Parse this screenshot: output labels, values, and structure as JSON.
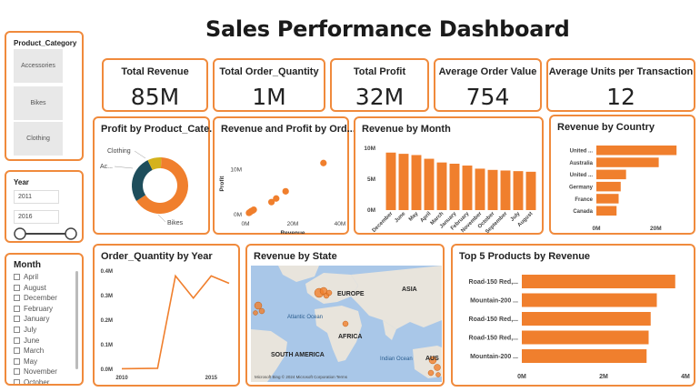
{
  "dashboard": {
    "title": "Sales Performance Dashboard"
  },
  "kpis": [
    {
      "label": "Total Revenue",
      "value": "85M"
    },
    {
      "label": "Total Order_Quantity",
      "value": "1M"
    },
    {
      "label": "Total Profit",
      "value": "32M"
    },
    {
      "label": "Average Order Value",
      "value": "754"
    },
    {
      "label": "Average Units per Transaction",
      "value": "12"
    }
  ],
  "slicers": {
    "category": {
      "title": "Product_Category",
      "items": [
        "Accessories",
        "Bikes",
        "Clothing"
      ]
    },
    "year": {
      "title": "Year",
      "from": "2011",
      "to": "2016"
    },
    "month": {
      "title": "Month",
      "items": [
        "April",
        "August",
        "December",
        "February",
        "January",
        "July",
        "June",
        "March",
        "May",
        "November",
        "October"
      ]
    }
  },
  "charts": {
    "profit_by_category": {
      "title": "Profit by Product_Cate...",
      "chart_data": {
        "type": "pie",
        "labels": [
          "Bikes",
          "Accessories",
          "Clothing"
        ],
        "display_labels": [
          "Bikes",
          "Ac...",
          "Clothing"
        ],
        "values": [
          65,
          27,
          8
        ],
        "colors": [
          "#f07f2d",
          "#1e4e5c",
          "#d4b21c"
        ]
      }
    },
    "revenue_profit_by_order": {
      "title": "Revenue and Profit by Ord...",
      "chart_data": {
        "type": "scatter",
        "xlabel": "Revenue",
        "ylabel": "Profit",
        "x_ticks": [
          "0M",
          "20M",
          "40M"
        ],
        "y_ticks": [
          "0M",
          "10M"
        ],
        "xlim": [
          0,
          40
        ],
        "ylim": [
          0,
          15
        ],
        "points": [
          [
            1.5,
            0.4
          ],
          [
            2.0,
            0.6
          ],
          [
            2.5,
            0.8
          ],
          [
            3.0,
            0.9
          ],
          [
            3.5,
            1.1
          ],
          [
            11,
            2.8
          ],
          [
            13,
            3.6
          ],
          [
            17,
            5.2
          ],
          [
            33,
            11.5
          ]
        ]
      }
    },
    "revenue_by_month": {
      "title": "Revenue by Month",
      "chart_data": {
        "type": "bar",
        "categories": [
          "December",
          "June",
          "May",
          "April",
          "March",
          "January",
          "February",
          "November",
          "October",
          "September",
          "July",
          "August"
        ],
        "values": [
          9.3,
          9.1,
          8.9,
          8.3,
          7.7,
          7.5,
          7.2,
          6.7,
          6.5,
          6.4,
          6.3,
          6.2
        ],
        "y_ticks": [
          "0M",
          "5M",
          "10M"
        ],
        "ylim": [
          0,
          10
        ]
      }
    },
    "revenue_by_country": {
      "title": "Revenue by Country",
      "chart_data": {
        "type": "bar",
        "orientation": "horizontal",
        "categories": [
          "United ...",
          "Australia",
          "United ...",
          "Germany",
          "France",
          "Canada"
        ],
        "values": [
          27,
          21,
          10,
          8.2,
          7.5,
          6.8
        ],
        "x_ticks": [
          "0M",
          "20M"
        ],
        "xlim": [
          0,
          30
        ]
      }
    },
    "order_qty_by_year": {
      "title": "Order_Quantity by Year",
      "chart_data": {
        "type": "line",
        "x": [
          2011,
          2012,
          2013,
          2014,
          2015,
          2016
        ],
        "values": [
          0,
          0,
          0.38,
          0.29,
          0.38,
          0
        ],
        "plot_x": [
          2010,
          2011,
          2012,
          2013,
          2014,
          2015,
          2016
        ],
        "plot_values": [
          0.002,
          0.003,
          0.004,
          0.38,
          0.29,
          0.38,
          0.35
        ],
        "y_ticks": [
          "0.0M",
          "0.1M",
          "0.2M",
          "0.3M",
          "0.4M"
        ],
        "x_ticks": [
          "2010",
          "2015"
        ],
        "ylim": [
          0,
          0.4
        ],
        "xlim": [
          2010,
          2016
        ]
      }
    },
    "revenue_by_state": {
      "title": "Revenue by State",
      "map_labels": [
        "EUROPE",
        "ASIA",
        "Atlantic Ocean",
        "AFRICA",
        "SOUTH AMERICA",
        "Indian Ocean",
        "AUS"
      ],
      "credit": "Microsoft Bing © 2024 Microsoft Corporation Terms"
    },
    "top_products": {
      "title": "Top 5 Products by Revenue",
      "chart_data": {
        "type": "bar",
        "orientation": "horizontal",
        "categories": [
          "Road-150 Red,...",
          "Mountain-200 ...",
          "Road-150 Red,...",
          "Road-150 Red,...",
          "Mountain-200 ..."
        ],
        "values": [
          3.75,
          3.3,
          3.15,
          3.1,
          3.05
        ],
        "x_ticks": [
          "0M",
          "2M",
          "4M"
        ],
        "xlim": [
          0,
          4
        ]
      }
    }
  },
  "colors": {
    "accent": "#f07f2d",
    "border": "#f08a3c",
    "dark_teal": "#1e4e5c",
    "gold": "#d4b21c"
  }
}
